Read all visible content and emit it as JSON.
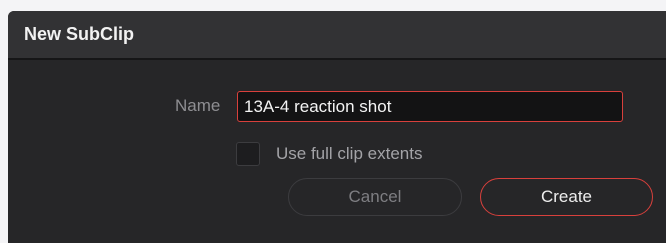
{
  "dialog": {
    "title": "New SubClip",
    "name_label": "Name",
    "name_value": "13A-4 reaction shot",
    "checkbox_label": "Use full clip extents",
    "checkbox_checked": false,
    "cancel_label": "Cancel",
    "create_label": "Create"
  },
  "colors": {
    "accent": "#d8403c",
    "dialog_bg": "#262628",
    "titlebar_bg": "#323234"
  }
}
